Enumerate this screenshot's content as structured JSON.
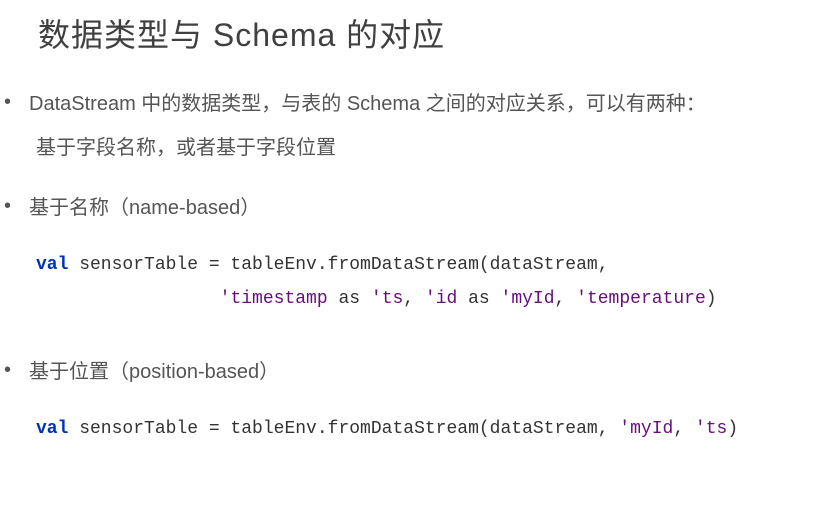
{
  "title": "数据类型与 Schema 的对应",
  "bullet1": {
    "line1": "DataStream 中的数据类型，与表的 Schema 之间的对应关系，可以有两种：",
    "line2": "基于字段名称，或者基于字段位置"
  },
  "section_name": {
    "label": "基于名称（name-based）"
  },
  "code1": {
    "kw": "val",
    "line1_rest": " sensorTable = tableEnv.fromDataStream(dataStream,",
    "line2_indent": "                 ",
    "sym1": "'timestamp",
    "as1": " as ",
    "sym2": "'ts",
    "comma1": ", ",
    "sym3": "'id",
    "as2": " as ",
    "sym4": "'myId",
    "comma2": ", ",
    "sym5": "'temperature",
    "close": ")"
  },
  "section_pos": {
    "label": "基于位置（position-based）"
  },
  "code2": {
    "kw": "val",
    "rest": " sensorTable = tableEnv.fromDataStream(dataStream, ",
    "sym1": "'myId",
    "comma1": ", ",
    "sym2": "'ts",
    "close": ")"
  }
}
